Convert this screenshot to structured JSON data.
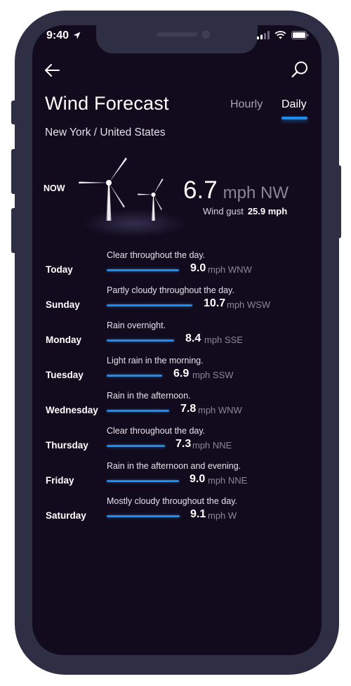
{
  "status_bar": {
    "time": "9:40"
  },
  "header": {
    "title": "Wind Forecast",
    "tabs": [
      {
        "label": "Hourly",
        "active": false
      },
      {
        "label": "Daily",
        "active": true
      }
    ],
    "location": "New York / United States",
    "accent_color": "#1f8cf0"
  },
  "now": {
    "label": "NOW",
    "speed": "6.7",
    "unit": "mph NW",
    "gust_label": "Wind gust",
    "gust_value": "25.9 mph"
  },
  "days": [
    {
      "name": "Today",
      "desc": "Clear throughout the day.",
      "speed": "9.0",
      "unit": "mph WNW"
    },
    {
      "name": "Sunday",
      "desc": "Partly cloudy throughout the day.",
      "speed": "10.7",
      "unit": "mph WSW"
    },
    {
      "name": "Monday",
      "desc": "Rain overnight.",
      "speed": "8.4",
      "unit": "mph SSE"
    },
    {
      "name": "Tuesday",
      "desc": "Light rain in the morning.",
      "speed": "6.9",
      "unit": "mph SSW"
    },
    {
      "name": "Wednesday",
      "desc": "Rain in the afternoon.",
      "speed": "7.8",
      "unit": "mph WNW"
    },
    {
      "name": "Thursday",
      "desc": "Clear throughout the day.",
      "speed": "7.3",
      "unit": "mph NNE"
    },
    {
      "name": "Friday",
      "desc": "Rain in the afternoon and evening.",
      "speed": "9.0",
      "unit": "mph NNE"
    },
    {
      "name": "Saturday",
      "desc": "Mostly cloudy throughout the day.",
      "speed": "9.1",
      "unit": "mph W"
    }
  ]
}
